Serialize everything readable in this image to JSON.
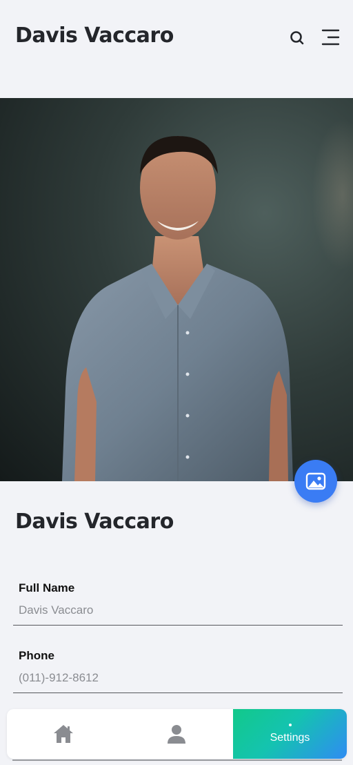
{
  "header": {
    "title": "Davis Vaccaro",
    "search_icon": "search-icon",
    "menu_icon": "menu-icon"
  },
  "photo": {
    "fab_icon": "image-icon"
  },
  "profile": {
    "name": "Davis Vaccaro",
    "fields": [
      {
        "label": "Full Name",
        "value": "Davis Vaccaro"
      },
      {
        "label": "Phone",
        "value": "(011)-912-8612"
      }
    ]
  },
  "bottom_nav": {
    "items": [
      {
        "icon": "home-icon",
        "label": ""
      },
      {
        "icon": "person-icon",
        "label": ""
      },
      {
        "icon": "",
        "label": "Settings",
        "active": true
      }
    ]
  },
  "colors": {
    "background": "#f2f3f7",
    "accent": "#3a7cf4",
    "active_gradient_start": "#12c98a",
    "active_gradient_end": "#2f8cf2",
    "title": "#24262b",
    "muted": "#8a8c91"
  }
}
